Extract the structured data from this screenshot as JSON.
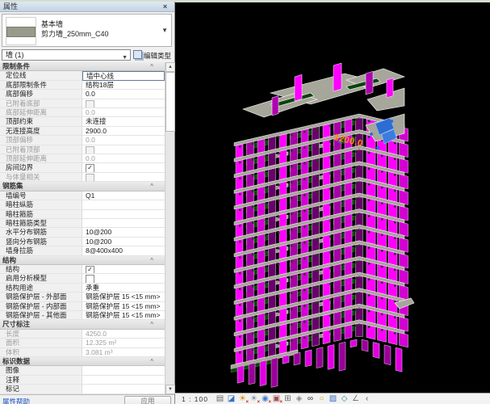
{
  "panel": {
    "title": "属性",
    "close_icon": "×",
    "type_selector": {
      "family": "基本墙",
      "type_name": "剪力墙_250mm_C40"
    },
    "selection_label": "墙 (1)",
    "edit_type_label": "编辑类型",
    "help_link": "属性帮助",
    "apply_button": "应用",
    "rows": [
      {
        "kind": "section",
        "label": "限制条件"
      },
      {
        "kind": "row",
        "label": "定位线",
        "value": "墙中心线",
        "selected": true
      },
      {
        "kind": "row",
        "label": "底部限制条件",
        "value": "结构18层"
      },
      {
        "kind": "row",
        "label": "底部偏移",
        "value": "0.0"
      },
      {
        "kind": "row",
        "label": "已附着底部",
        "checkbox": true,
        "checked": false,
        "disabled": true
      },
      {
        "kind": "row",
        "label": "底部延伸距离",
        "value": "0.0",
        "disabled": true
      },
      {
        "kind": "row",
        "label": "顶部约束",
        "value": "未连接"
      },
      {
        "kind": "row",
        "label": "无连接高度",
        "value": "2900.0"
      },
      {
        "kind": "row",
        "label": "顶部偏移",
        "value": "0.0",
        "disabled": true
      },
      {
        "kind": "row",
        "label": "已附着顶部",
        "checkbox": true,
        "checked": false,
        "disabled": true
      },
      {
        "kind": "row",
        "label": "顶部延伸距离",
        "value": "0.0",
        "disabled": true
      },
      {
        "kind": "row",
        "label": "房间边界",
        "checkbox": true,
        "checked": true
      },
      {
        "kind": "row",
        "label": "与体量相关",
        "checkbox": true,
        "checked": false,
        "disabled": true
      },
      {
        "kind": "section",
        "label": "钢筋集"
      },
      {
        "kind": "row",
        "label": "墙编号",
        "value": "Q1"
      },
      {
        "kind": "row",
        "label": "暗柱纵筋",
        "value": ""
      },
      {
        "kind": "row",
        "label": "暗柱箍筋",
        "value": ""
      },
      {
        "kind": "row",
        "label": "暗柱箍筋类型",
        "value": ""
      },
      {
        "kind": "row",
        "label": "水平分布钢筋",
        "value": "10@200"
      },
      {
        "kind": "row",
        "label": "竖向分布钢筋",
        "value": "10@200"
      },
      {
        "kind": "row",
        "label": "墙身拉筋",
        "value": "8@400x400"
      },
      {
        "kind": "section",
        "label": "结构"
      },
      {
        "kind": "row",
        "label": "结构",
        "checkbox": true,
        "checked": true
      },
      {
        "kind": "row",
        "label": "启用分析模型",
        "checkbox": true,
        "checked": false
      },
      {
        "kind": "row",
        "label": "结构用途",
        "value": "承重"
      },
      {
        "kind": "row",
        "label": "钢筋保护层 - 外部面",
        "value": "钢筋保护层 15 <15 mm>"
      },
      {
        "kind": "row",
        "label": "钢筋保护层 - 内部面",
        "value": "钢筋保护层 15 <15 mm>"
      },
      {
        "kind": "row",
        "label": "钢筋保护层 - 其他面",
        "value": "钢筋保护层 15 <15 mm>"
      },
      {
        "kind": "section",
        "label": "尺寸标注"
      },
      {
        "kind": "row",
        "label": "长度",
        "value": "4250.0",
        "disabled": true
      },
      {
        "kind": "row",
        "label": "面积",
        "value": "12.325 m²",
        "disabled": true
      },
      {
        "kind": "row",
        "label": "体积",
        "value": "3.081 m³",
        "disabled": true
      },
      {
        "kind": "section",
        "label": "标识数据"
      },
      {
        "kind": "row",
        "label": "图像",
        "value": ""
      },
      {
        "kind": "row",
        "label": "注释",
        "value": ""
      },
      {
        "kind": "row",
        "label": "标记",
        "value": ""
      }
    ]
  },
  "viewport": {
    "dimension_label": "3200.0",
    "colors": {
      "wall_magenta": "#ff00ff",
      "wall_purple": "#a800a8",
      "slab_gray": "#a6a69a",
      "balcony_green": "#0c420c",
      "selection_blue": "#2e6cd4",
      "dimension_orange": "#ff9000",
      "background": "#000000"
    }
  },
  "viewbar": {
    "scale": "1 : 100",
    "icons": [
      {
        "name": "detail-level-icon",
        "glyph": "▤",
        "color": "#6a6a6a",
        "badge": ""
      },
      {
        "name": "visual-style-icon",
        "glyph": "◪",
        "color": "#3a6fc0",
        "badge": ""
      },
      {
        "name": "sun-path-icon",
        "glyph": "☀",
        "color": "#e08a00",
        "badge": "×"
      },
      {
        "name": "shadows-icon",
        "glyph": "☀",
        "color": "#7a8aa0",
        "badge": "×"
      },
      {
        "name": "rendering-dialog-icon",
        "glyph": "◉",
        "color": "#4a7fd0",
        "badge": "×"
      },
      {
        "name": "crop-view-icon",
        "glyph": "▣",
        "color": "#a05050",
        "badge": "×"
      },
      {
        "name": "show-crop-region-icon",
        "glyph": "⊞",
        "color": "#6a6a6a",
        "badge": ""
      },
      {
        "name": "lock-3d-view-icon",
        "glyph": "◈",
        "color": "#888888",
        "badge": ""
      },
      {
        "name": "temporary-hide-isolate-icon",
        "glyph": "∞",
        "color": "#333333",
        "badge": ""
      },
      {
        "name": "reveal-hidden-elements-icon",
        "glyph": "○",
        "color": "#c8a000",
        "badge": ""
      },
      {
        "name": "temporary-view-properties-icon",
        "glyph": "▨",
        "color": "#3a6fc0",
        "badge": ""
      },
      {
        "name": "show-analytical-model-icon",
        "glyph": "◇",
        "color": "#2a8a8a",
        "badge": ""
      },
      {
        "name": "reveal-constraints-icon",
        "glyph": "∠",
        "color": "#777777",
        "badge": ""
      },
      {
        "name": "more-options-caret",
        "glyph": "‹",
        "color": "#555555",
        "badge": ""
      }
    ]
  }
}
